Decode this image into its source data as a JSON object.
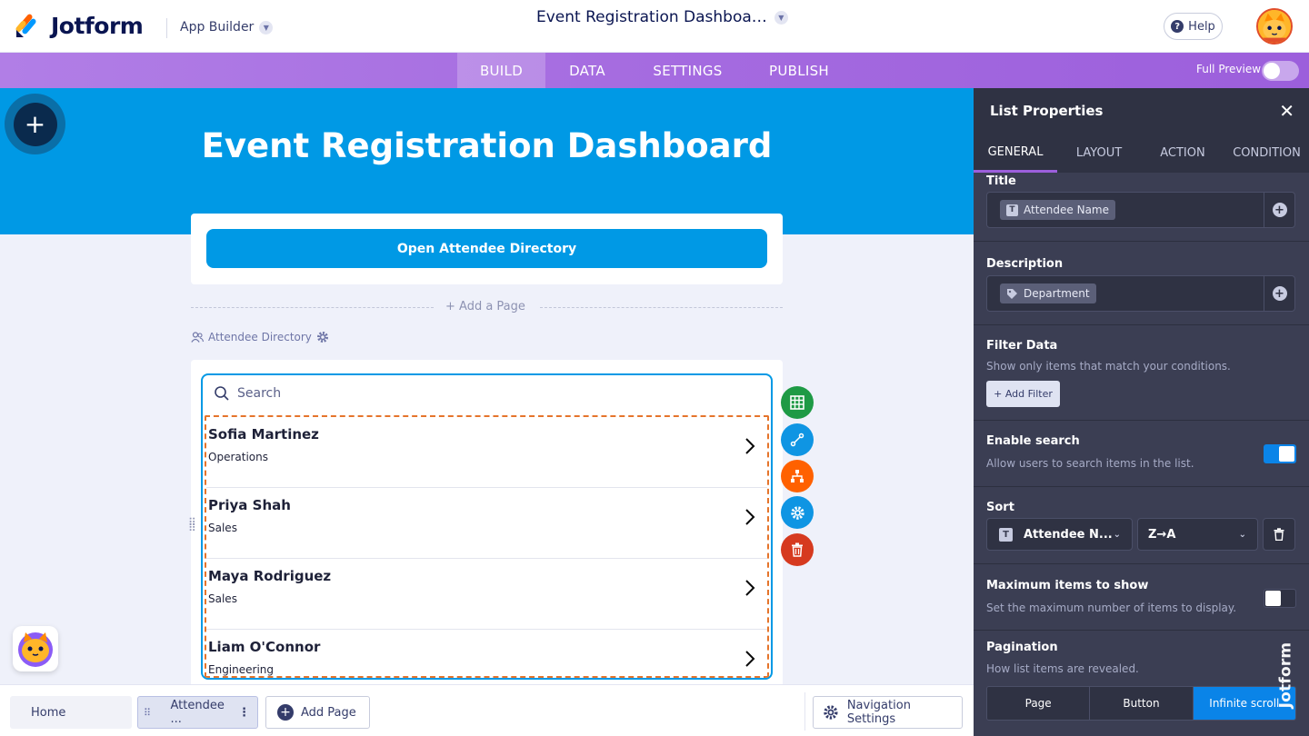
{
  "topbar": {
    "brand": "Jotform",
    "builder_label": "App Builder",
    "app_title": "Event Registration Dashboa…",
    "help_label": "Help"
  },
  "nav": {
    "tabs": [
      "BUILD",
      "DATA",
      "SETTINGS",
      "PUBLISH"
    ],
    "active_tab": "BUILD",
    "full_preview_label": "Full Preview",
    "full_preview_on": false
  },
  "canvas": {
    "heading": "Event Registration Dashboard",
    "open_button_label": "Open Attendee Directory",
    "add_page_label": "+ Add a Page",
    "page_label": "Attendee Directory",
    "search_placeholder": "Search",
    "list_items": [
      {
        "name": "Sofia Martinez",
        "department": "Operations"
      },
      {
        "name": "Priya Shah",
        "department": "Sales"
      },
      {
        "name": "Maya Rodriguez",
        "department": "Sales"
      },
      {
        "name": "Liam O'Connor",
        "department": "Engineering"
      }
    ]
  },
  "side_tools": [
    "table-icon",
    "connect-icon",
    "hierarchy-icon",
    "gear-icon",
    "trash-icon"
  ],
  "bottombar": {
    "home_label": "Home",
    "current_page_label": "Attendee ...",
    "add_page_label": "Add Page",
    "nav_settings_label": "Navigation Settings"
  },
  "panel": {
    "title": "List Properties",
    "tabs": [
      "GENERAL",
      "LAYOUT",
      "ACTION",
      "CONDITION"
    ],
    "active_tab": "GENERAL",
    "title_section": {
      "label": "Title",
      "chip": "Attendee Name"
    },
    "description_section": {
      "label": "Description",
      "chip": "Department"
    },
    "filter_section": {
      "label": "Filter Data",
      "desc": "Show only items that match your conditions.",
      "button": "+ Add Filter"
    },
    "search_section": {
      "label": "Enable search",
      "desc": "Allow users to search items in the list.",
      "enabled": true
    },
    "sort_section": {
      "label": "Sort",
      "field": "Attendee N...",
      "order": "Z→A"
    },
    "max_section": {
      "label": "Maximum items to show",
      "desc": "Set the maximum number of items to display.",
      "enabled": false
    },
    "pagination_section": {
      "label": "Pagination",
      "desc": "How list items are revealed.",
      "options": [
        "Page",
        "Button",
        "Infinite scroll"
      ],
      "selected": "Infinite scroll"
    },
    "watermark_text": "Jotform"
  },
  "colors": {
    "brand_blue": "#0099e5",
    "nav_purple": "#a56be0",
    "panel_bg": "#3b3e53",
    "list_outline": "#e5742b",
    "tool_green": "#1e9a45",
    "tool_blue": "#0f95e3",
    "tool_orange": "#ff6100",
    "tool_red": "#d63a1f"
  }
}
